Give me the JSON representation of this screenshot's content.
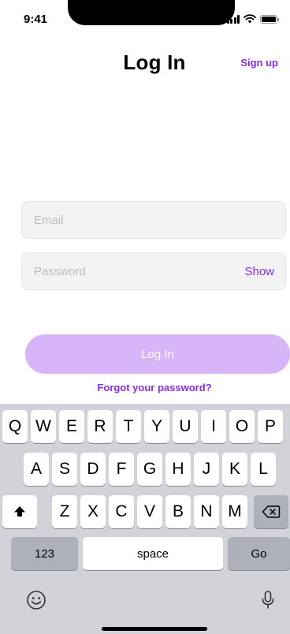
{
  "status_bar": {
    "time": "9:41"
  },
  "header": {
    "title": "Log In",
    "signup_label": "Sign up"
  },
  "form": {
    "email_placeholder": "Email",
    "password_placeholder": "Password",
    "show_label": "Show",
    "login_label": "Log In",
    "forgot_label": "Forgot your password?"
  },
  "keyboard": {
    "row1": [
      "Q",
      "W",
      "E",
      "R",
      "T",
      "Y",
      "U",
      "I",
      "O",
      "P"
    ],
    "row2": [
      "A",
      "S",
      "D",
      "F",
      "G",
      "H",
      "J",
      "K",
      "L"
    ],
    "row3": [
      "Z",
      "X",
      "C",
      "V",
      "B",
      "N",
      "M"
    ],
    "numbers_label": "123",
    "space_label": "space",
    "go_label": "Go",
    "icons": [
      "shift-icon",
      "backspace-icon",
      "emoji-icon",
      "microphone-icon"
    ]
  },
  "colors": {
    "accent": "#8a2be2",
    "button_disabled": "#d8b4f8",
    "field_bg": "#f3f3f3",
    "keyboard_bg": "#d1d3d9"
  }
}
